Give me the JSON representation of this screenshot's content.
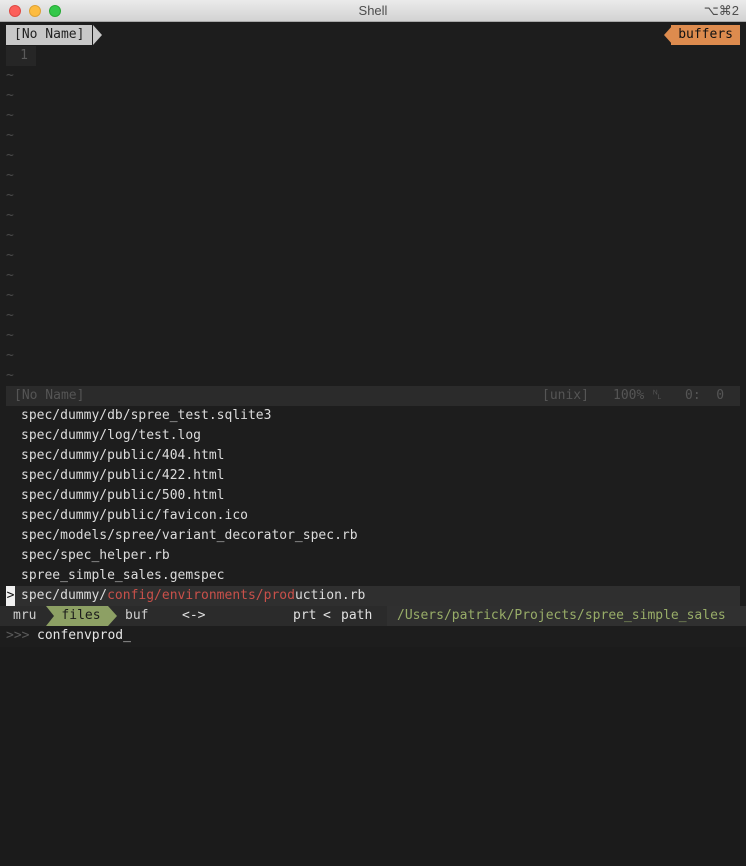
{
  "window": {
    "title": "Shell",
    "shortcut": "⌥⌘2"
  },
  "tabline": {
    "buffer_name": "[No Name]",
    "buffers_label": "buffers"
  },
  "editor": {
    "line_number": "1",
    "tilde_char": "~",
    "tilde_count": 16
  },
  "statusline": {
    "name": "[No Name]",
    "fileformat": "[unix]",
    "percent": "100%",
    "line_icon": "␤",
    "position": "0:  0"
  },
  "results": {
    "items": [
      "spec/dummy/db/spree_test.sqlite3",
      "spec/dummy/log/test.log",
      "spec/dummy/public/404.html",
      "spec/dummy/public/422.html",
      "spec/dummy/public/500.html",
      "spec/dummy/public/favicon.ico",
      "spec/models/spree/variant_decorator_spec.rb",
      "spec/spec_helper.rb",
      "spree_simple_sales.gemspec"
    ],
    "selected": {
      "marker": ">",
      "part1": "spec/dummy/",
      "match1": "config/environments/prod",
      "part2": "uction.rb"
    }
  },
  "ctrlp": {
    "mru": "mru",
    "files": "files",
    "buf": "buf",
    "dir_toggle": "<->",
    "prt": "prt",
    "chevron": "<",
    "path_label": "path",
    "path": "/Users/patrick/Projects/spree_simple_sales"
  },
  "prompt": {
    "chevrons": ">>>",
    "input": "confenvprod_"
  }
}
